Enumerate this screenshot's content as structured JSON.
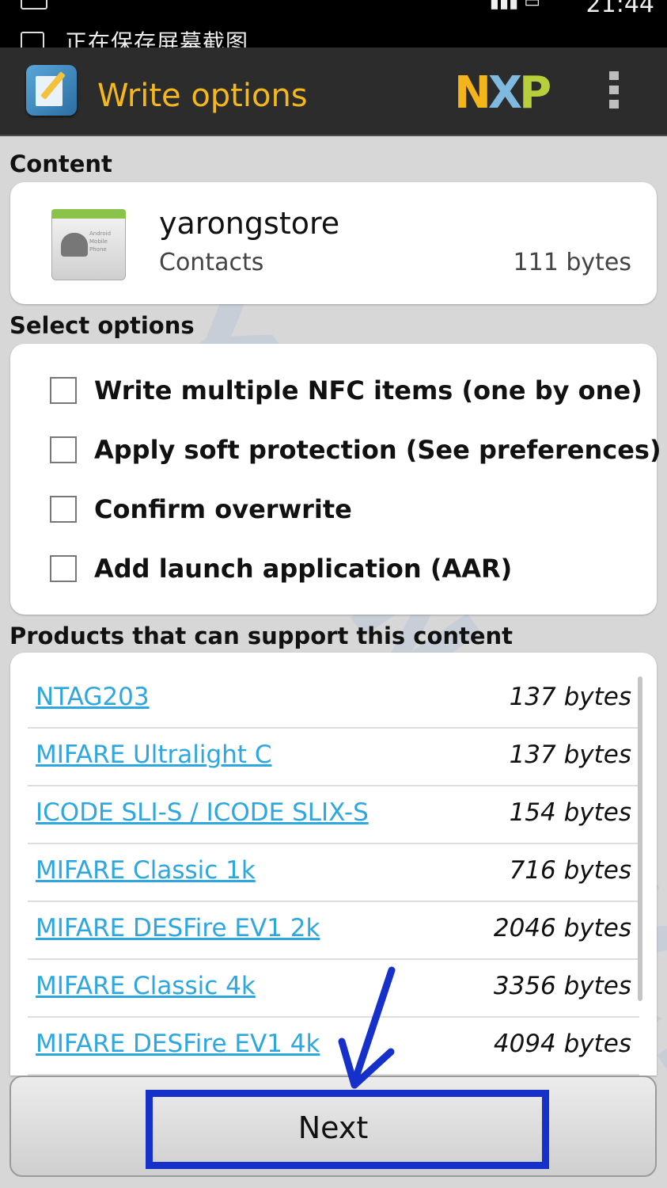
{
  "status_bar": {
    "notification_text": "正在保存屏幕截图",
    "clock": "21:44"
  },
  "action_bar": {
    "title": "Write options",
    "brand": {
      "n": "N",
      "x": "X",
      "p": "P"
    },
    "accent_color": "#f5b81a"
  },
  "content": {
    "heading": "Content",
    "item": {
      "name": "yarongstore",
      "type": "Contacts",
      "size": "111 bytes",
      "icon_text": [
        "Android",
        "Mobile",
        "Phone"
      ]
    }
  },
  "options": {
    "heading": "Select options",
    "items": [
      {
        "label": "Write multiple NFC items (one by one)",
        "checked": false
      },
      {
        "label": "Apply soft protection (See preferences)",
        "checked": false
      },
      {
        "label": "Confirm overwrite",
        "checked": false
      },
      {
        "label": "Add launch application (AAR)",
        "checked": false
      }
    ]
  },
  "products": {
    "heading": "Products that can support this content",
    "link_color": "#2ea7e0",
    "items": [
      {
        "name": "NTAG203",
        "size": "137 bytes"
      },
      {
        "name": "MIFARE Ultralight C",
        "size": "137 bytes"
      },
      {
        "name": "ICODE SLI-S / ICODE SLIX-S",
        "size": "154 bytes"
      },
      {
        "name": "MIFARE Classic 1k",
        "size": "716 bytes"
      },
      {
        "name": "MIFARE DESFire EV1 2k",
        "size": "2046 bytes"
      },
      {
        "name": "MIFARE Classic 4k",
        "size": "3356 bytes"
      },
      {
        "name": "MIFARE DESFire EV1 4k",
        "size": "4094 bytes"
      }
    ]
  },
  "next_button": {
    "label": "Next"
  },
  "watermark": "YRONGTECH"
}
